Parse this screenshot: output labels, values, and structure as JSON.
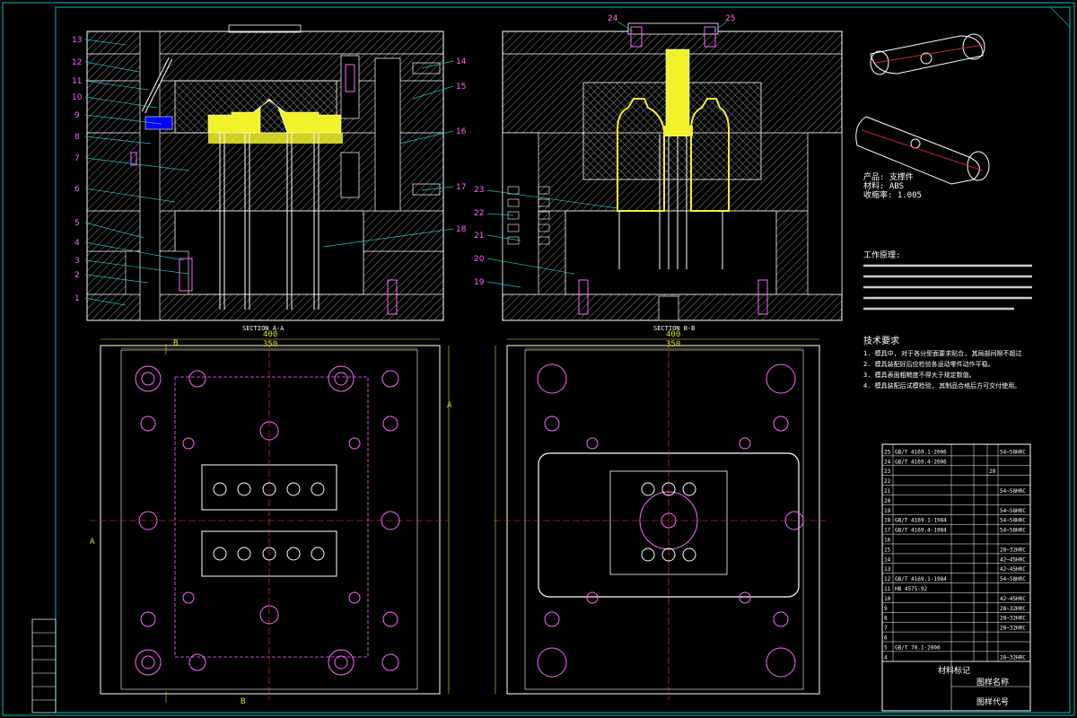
{
  "drawing": {
    "section_a": "SECTION A-A",
    "section_b": "SECTION B-B",
    "left_callouts": [
      "13",
      "12",
      "11",
      "10",
      "9",
      "8",
      "7",
      "6",
      "5",
      "4",
      "3",
      "2",
      "1"
    ],
    "right_callouts_a": [
      "14",
      "15",
      "16",
      "17",
      "18"
    ],
    "top_callouts_b": [
      "24",
      "25"
    ],
    "left_callouts_b": [
      "23",
      "22",
      "21",
      "20",
      "19"
    ],
    "dim_400": "400",
    "dim_350": "350",
    "mark_a": "A",
    "mark_b": "B"
  },
  "part_info": {
    "lines": [
      "产品: 支撑件",
      "材料: ABS",
      "收缩率: 1.005"
    ]
  },
  "sections": {
    "work_title": "工作原理:",
    "tech_title": "技术要求",
    "tech_lines": [
      "1. 模具中, 对于各分型面要求贴合, 其局部间隙不超过",
      "2. 模具装配好后应检验各运动零件动作平稳。",
      "3. 模具表面粗糙度不得大于规定数值。",
      "4. 模具装配后试模检验, 其制品合格后方可交付使用。"
    ]
  },
  "bom": {
    "rows": [
      [
        "25",
        "GB/T 4169.1-2006",
        "",
        "",
        "",
        "54~58HRC"
      ],
      [
        "24",
        "GB/T 4169.4-2006",
        "",
        "",
        "",
        ""
      ],
      [
        "23",
        "",
        "",
        "",
        "20",
        ""
      ],
      [
        "22",
        "",
        "",
        "",
        "",
        ""
      ],
      [
        "21",
        "",
        "",
        "",
        "",
        "54~58HRC"
      ],
      [
        "20",
        "",
        "",
        "",
        "",
        ""
      ],
      [
        "19",
        "",
        "",
        "",
        "",
        "54~58HRC"
      ],
      [
        "18",
        "GB/T 4169.1-1984",
        "",
        "",
        "",
        "54~58HRC"
      ],
      [
        "17",
        "GB/T 4169.4-1984",
        "",
        "",
        "",
        "54~58HRC"
      ],
      [
        "16",
        "",
        "",
        "",
        "",
        ""
      ],
      [
        "15",
        "",
        "",
        "",
        "",
        "28~32HRC"
      ],
      [
        "14",
        "",
        "",
        "",
        "",
        "42~45HRC"
      ],
      [
        "13",
        "",
        "",
        "",
        "",
        "42~45HRC"
      ],
      [
        "12",
        "GB/T 4169.1-1984",
        "",
        "",
        "",
        "54~58HRC"
      ],
      [
        "11",
        "HB 4575-92",
        "",
        "",
        "",
        ""
      ],
      [
        "10",
        "",
        "",
        "",
        "",
        "42~45HRC"
      ],
      [
        "9",
        "",
        "",
        "",
        "",
        "28~32HRC"
      ],
      [
        "8",
        "",
        "",
        "",
        "",
        "28~32HRC"
      ],
      [
        "7",
        "",
        "",
        "",
        "",
        "28~32HRC"
      ],
      [
        "6",
        "",
        "",
        "",
        "",
        ""
      ],
      [
        "5",
        "GB/T 70.1-2000",
        "",
        "",
        "",
        ""
      ],
      [
        "4",
        "",
        "",
        "",
        "",
        "28~32HRC"
      ]
    ],
    "title_block": "材料标记",
    "drawing_name": "图样名称",
    "drawing_code": "图样代号"
  },
  "colors": {
    "background": "#000000",
    "frame": "#00c0c0",
    "hatch": "#8a8a8a",
    "mold_outline": "#ffffff",
    "part": "#f2f22a",
    "callout": "#ff66ff",
    "centerline": "#ff3333",
    "leader": "#20c0c0",
    "dim": "#e0e030"
  }
}
